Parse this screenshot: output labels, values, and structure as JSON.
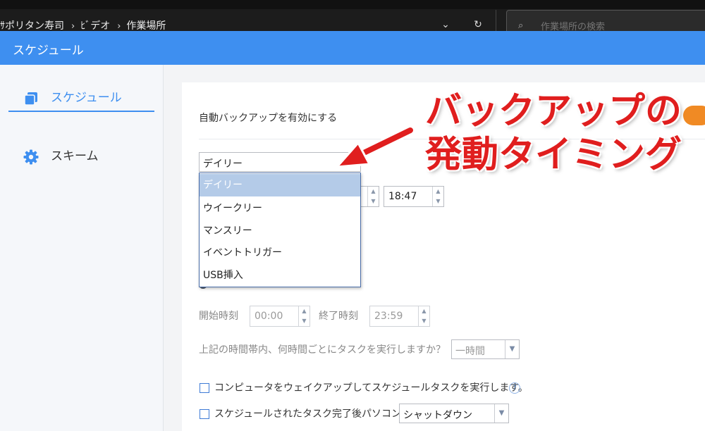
{
  "explorer": {
    "breadcrumb": [
      "ｻポリタン寿司",
      "ﾋﾞデオ",
      "作業場所"
    ],
    "breadcrumb_sep": "›",
    "search_placeholder": "作業場所の検索"
  },
  "app": {
    "title": "スケジュール"
  },
  "sidebar": {
    "items": [
      {
        "label": "スケジュール",
        "icon": "copy-icon",
        "active": true
      },
      {
        "label": "スキーム",
        "icon": "gear-icon",
        "active": false
      }
    ]
  },
  "schedule": {
    "enable_label": "自動バックアップを有効にする",
    "frequency": {
      "selected": "デイリー",
      "options": [
        "デイリー",
        "ウイークリー",
        "マンスリー",
        "イベントトリガー",
        "USB挿入"
      ]
    },
    "time_value": "18:47",
    "start_label": "開始時刻",
    "start_value": "00:00",
    "end_label": "終了時刻",
    "end_value": "23:59",
    "interval_question": "上記の時間帯内、何時間ごとにタスクを実行しますか？",
    "interval_value": "一時間",
    "wake_label": "コンピュータをウェイクアップしてスケジュールタスクを実行します。",
    "help_glyph": "?",
    "after_label": "スケジュールされたタスク完了後パソコン",
    "after_value": "シャットダウン"
  },
  "annotation": {
    "line1": "バックアップの",
    "line2": "発動タイミング",
    "color": "#e01e1e"
  },
  "colors": {
    "accent": "#3e8ff0",
    "toggle": "#f08a24"
  }
}
